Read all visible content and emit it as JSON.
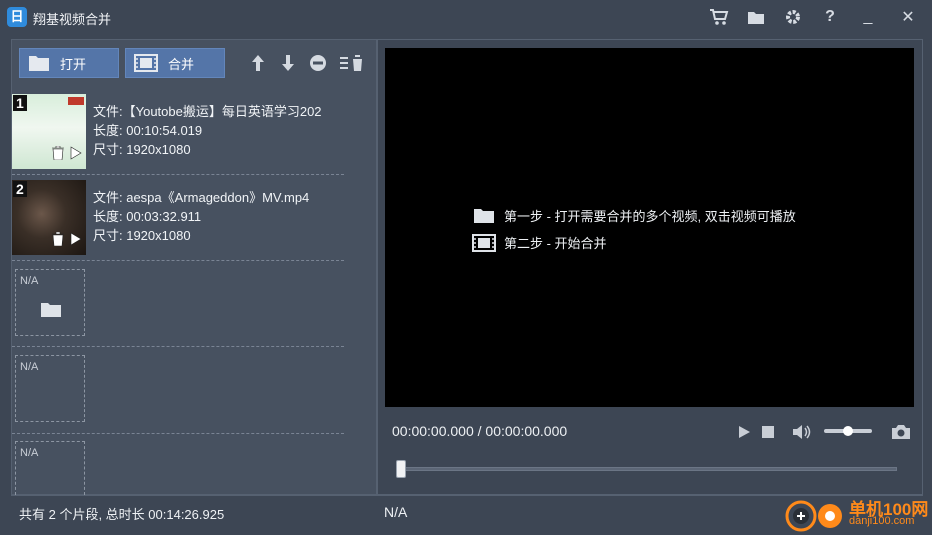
{
  "window": {
    "title": "翔基视频合并",
    "app_icon_glyph": "日"
  },
  "titlebar_icons": [
    "cart-icon",
    "folder-icon",
    "gear-icon",
    "help-icon",
    "minimize-icon",
    "close-icon"
  ],
  "titlebar_glyphs": {
    "help": "?",
    "minimize": "_",
    "close": "✕"
  },
  "toolbar": {
    "open_label": "打开",
    "merge_label": "合并"
  },
  "items": [
    {
      "index": "1",
      "file": "文件:【Youtobe搬运】每日英语学习202",
      "duration": "长度: 00:10:54.019",
      "size": "尺寸: 1920x1080",
      "thumb_color": "#e9f4ea"
    },
    {
      "index": "2",
      "file": "文件: aespa《Armageddon》MV.mp4",
      "duration": "长度: 00:03:32.911",
      "size": "尺寸: 1920x1080",
      "thumb_color": "#3a2f27"
    }
  ],
  "empty_slots": [
    {
      "label": "N/A"
    },
    {
      "label": "N/A"
    },
    {
      "label": "N/A"
    }
  ],
  "left_status": "共有 2 个片段, 总时长 00:14:26.925",
  "video": {
    "step1": "第一步 - 打开需要合并的多个视频, 双击视频可播放",
    "step2": "第二步 - 开始合并"
  },
  "player": {
    "timecode": "00:00:00.000 / 00:00:00.000",
    "volume_level": 0.5,
    "seek_position": 0
  },
  "right_status": "N/A",
  "watermark": {
    "title": "单机100网",
    "url": "danji100.com"
  },
  "colors": {
    "accent": "#5475a8",
    "background": "#3d4654",
    "video": "#000000",
    "watermark": "#ff8a1a"
  }
}
